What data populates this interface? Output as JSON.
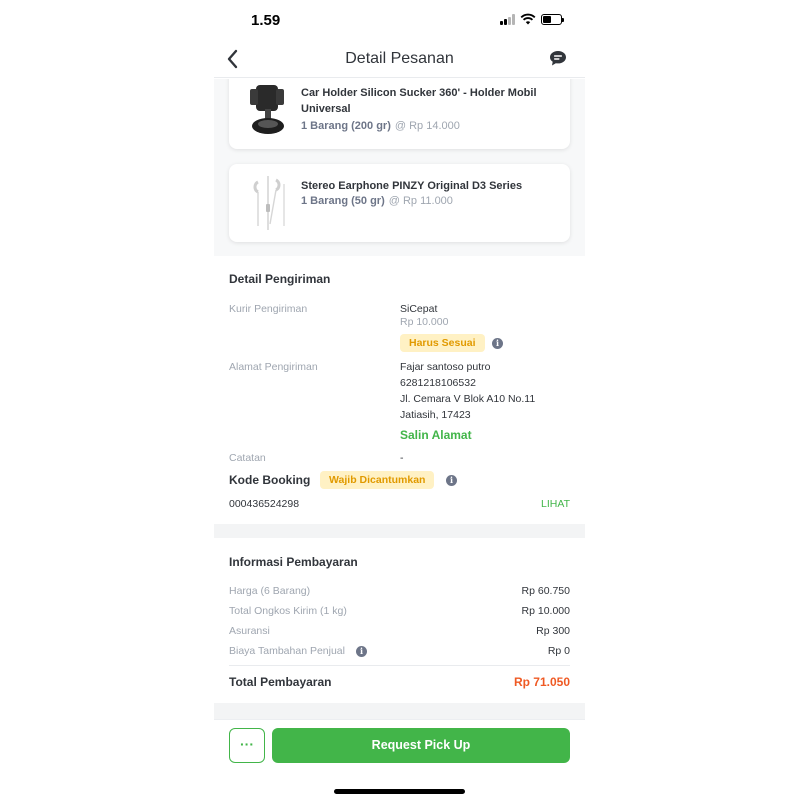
{
  "status_bar": {
    "time": "1.59"
  },
  "header": {
    "title": "Detail Pesanan",
    "back_icon": "chevron-left-icon",
    "chat_icon": "chat-bubble-icon"
  },
  "products": [
    {
      "name": "Car Holder Silicon Sucker 360' - Holder Mobil Universal",
      "qty": "1 Barang (200 gr)",
      "price": "@ Rp 14.000",
      "icon": "car-holder-image"
    },
    {
      "name": "Stereo Earphone PINZY Original D3 Series",
      "qty": "1 Barang (50 gr)",
      "price": "@ Rp 11.000",
      "icon": "earphone-image"
    }
  ],
  "shipping": {
    "title": "Detail Pengiriman",
    "courier_label": "Kurir Pengiriman",
    "courier": "SiCepat",
    "courier_cost": "Rp 10.000",
    "courier_badge": "Harus Sesuai",
    "address_label": "Alamat Pengiriman",
    "address_name": "Fajar santoso putro",
    "address_phone": "6281218106532",
    "address_street": "Jl. Cemara V Blok A10 No.11",
    "address_city": "Jatiasih, 17423",
    "copy_address": "Salin Alamat",
    "note_label": "Catatan",
    "note_value": "-",
    "booking_label": "Kode Booking",
    "booking_badge": "Wajib Dicantumkan",
    "booking_code": "000436524298",
    "booking_link": "LIHAT"
  },
  "payment": {
    "title": "Informasi Pembayaran",
    "rows": [
      {
        "label": "Harga (6 Barang)",
        "value": "Rp 60.750"
      },
      {
        "label": "Total Ongkos Kirim (1 kg)",
        "value": "Rp 10.000"
      },
      {
        "label": "Asuransi",
        "value": "Rp 300"
      },
      {
        "label": "Biaya Tambahan Penjual",
        "value": "Rp 0"
      }
    ],
    "total_label": "Total Pembayaran",
    "total_value": "Rp 71.050"
  },
  "bottom_bar": {
    "more_label": "···",
    "primary_label": "Request Pick Up"
  },
  "colors": {
    "primary": "#42b549",
    "accent_total": "#ef5a24",
    "badge_bg": "#fff1c4",
    "badge_text": "#e19a00"
  }
}
